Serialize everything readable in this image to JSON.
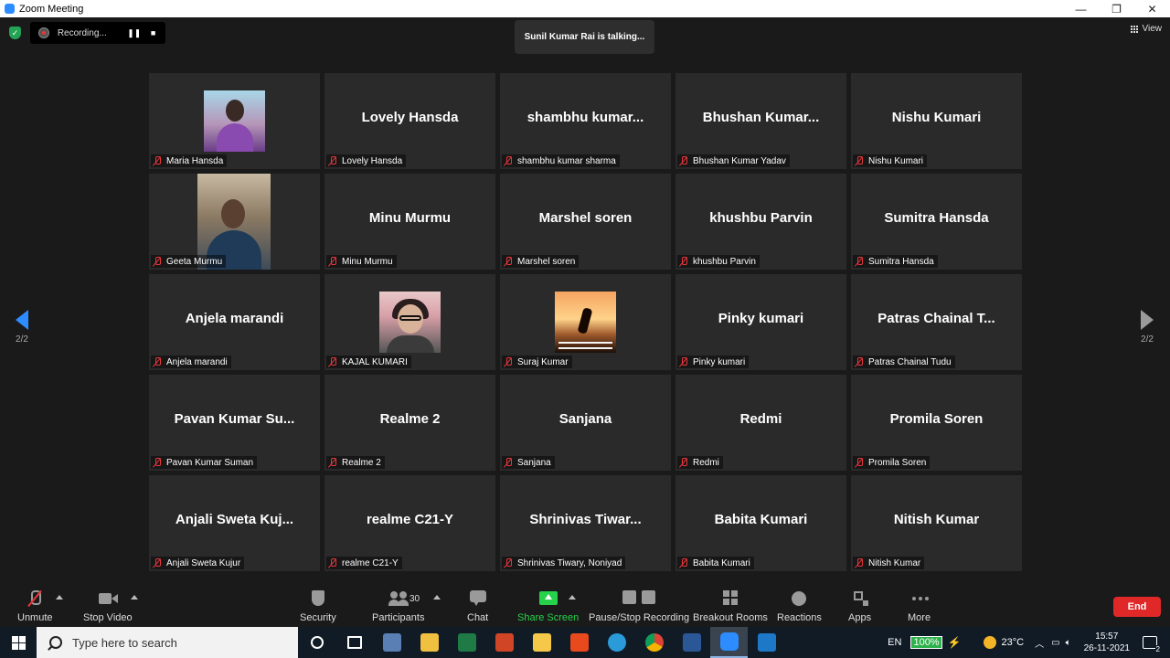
{
  "window": {
    "title": "Zoom Meeting",
    "controls": [
      "—",
      "❐",
      "✕"
    ]
  },
  "top": {
    "recording_label": "Recording...",
    "talking": "Sunil Kumar Rai is talking...",
    "view_label": "View",
    "page_indicator_left": "2/2",
    "page_indicator_right": "2/2"
  },
  "tiles": [
    {
      "display": "",
      "label": "Maria Hansda",
      "photo": "maria"
    },
    {
      "display": "Lovely Hansda",
      "label": "Lovely Hansda"
    },
    {
      "display": "shambhu  kumar...",
      "label": "shambhu kumar sharma"
    },
    {
      "display": "Bhushan  Kumar...",
      "label": "Bhushan Kumar Yadav"
    },
    {
      "display": "Nishu Kumari",
      "label": "Nishu Kumari"
    },
    {
      "display": "",
      "label": "Geeta Murmu",
      "photo": "geeta"
    },
    {
      "display": "Minu Murmu",
      "label": "Minu Murmu"
    },
    {
      "display": "Marshel soren",
      "label": "Marshel soren"
    },
    {
      "display": "khushbu Parvin",
      "label": "khushbu Parvin"
    },
    {
      "display": "Sumitra Hansda",
      "label": "Sumitra Hansda"
    },
    {
      "display": "Anjela marandi",
      "label": "Anjela marandi"
    },
    {
      "display": "",
      "label": "KAJAL KUMARI",
      "photo": "kajal"
    },
    {
      "display": "",
      "label": "Suraj Kumar",
      "photo": "suraj"
    },
    {
      "display": "Pinky kumari",
      "label": "Pinky kumari"
    },
    {
      "display": "Patras Chainal T...",
      "label": "Patras Chainal Tudu"
    },
    {
      "display": "Pavan Kumar Su...",
      "label": "Pavan Kumar Suman"
    },
    {
      "display": "Realme 2",
      "label": "Realme 2"
    },
    {
      "display": "Sanjana",
      "label": "Sanjana"
    },
    {
      "display": "Redmi",
      "label": "Redmi"
    },
    {
      "display": "Promila Soren",
      "label": "Promila Soren"
    },
    {
      "display": "Anjali  Sweta  Kuj...",
      "label": "Anjali Sweta Kujur"
    },
    {
      "display": "realme C21-Y",
      "label": "realme C21-Y"
    },
    {
      "display": "Shrinivas  Tiwar...",
      "label": "Shrinivas Tiwary, Noniyad"
    },
    {
      "display": "Babita Kumari",
      "label": "Babita Kumari"
    },
    {
      "display": "Nitish Kumar",
      "label": "Nitish Kumar"
    }
  ],
  "toolbar": {
    "unmute": "Unmute",
    "stop_video": "Stop Video",
    "security": "Security",
    "participants": "Participants",
    "participants_count": "30",
    "chat": "Chat",
    "share_screen": "Share Screen",
    "recording": "Pause/Stop Recording",
    "breakout": "Breakout Rooms",
    "reactions": "Reactions",
    "apps": "Apps",
    "more": "More",
    "end": "End",
    "share_color": "#27d24b",
    "end_color": "#e02828"
  },
  "taskbar": {
    "search_placeholder": "Type here to search",
    "apps": [
      "task-view",
      "file-explorer-alt",
      "store",
      "excel",
      "powerpoint",
      "file-explorer",
      "office",
      "edge",
      "chrome",
      "word",
      "zoom",
      "teams-like"
    ],
    "lang": "EN",
    "battery": "100%",
    "temperature": "23°C",
    "time": "15:57",
    "date": "26-11-2021",
    "notifications": "2"
  }
}
